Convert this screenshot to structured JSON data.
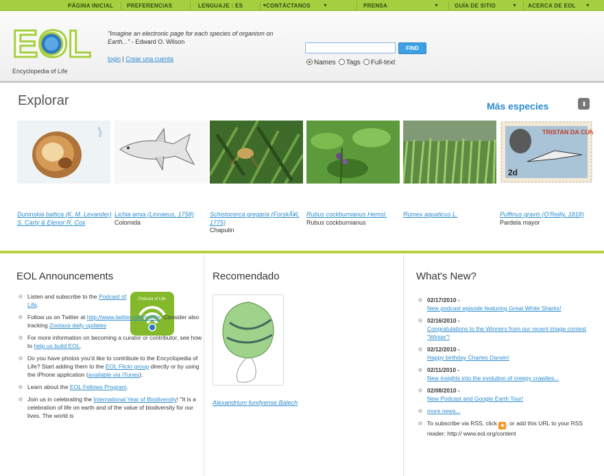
{
  "nav": {
    "items": [
      {
        "label": "PÁGINA INICIAL",
        "caret": false
      },
      {
        "label": "PREFERENCIAS",
        "caret": false
      },
      {
        "label": "LENGUAJE : ES",
        "caret": true
      },
      {
        "label": "CONTÁCTANOS",
        "caret": true
      },
      {
        "label": "PRENSA",
        "caret": true
      },
      {
        "label": "GUÍA DE SITIO",
        "caret": true
      },
      {
        "label": "ACERCA DE EOL",
        "caret": true
      }
    ]
  },
  "header": {
    "logo_text": "EOL",
    "logo_subtitle": "Encyclopedia of Life",
    "quote": "\"Imagine an electronic page for each species of organism on Earth...\"",
    "quote_author": "- Edward O. Wilson",
    "login": "login",
    "separator": "|",
    "create_account": "Crear una cuenta"
  },
  "search": {
    "placeholder": "",
    "button": "FIND",
    "options": [
      "Names",
      "Tags",
      "Full-text"
    ],
    "selected": "Names"
  },
  "explore": {
    "title": "Explorar",
    "more": "Más especies",
    "pause": "II",
    "species": [
      {
        "sci": "Duninskia baltica (K. M. Levander) S. Carty & Elenor R. Cox",
        "common": "",
        "icon": "cell-image"
      },
      {
        "sci": "Lichia amia (Linnaeus, 1758)",
        "common": "Colomida",
        "icon": "fish-image"
      },
      {
        "sci": "Schistocerca gregaria (ForskÃ¥l, 1775)",
        "common": "Chapulin",
        "icon": "locust-image"
      },
      {
        "sci": "Rubus cockburnianus Hemsl.",
        "common": "Rubus cockburnianus",
        "icon": "plant-image"
      },
      {
        "sci": "Rumex aquaticus L.",
        "common": "",
        "icon": "field-image"
      },
      {
        "sci": "Puffinus gravis (O'Reilly, 1818)",
        "common": "Pardela mayor",
        "icon": "stamp-image"
      }
    ]
  },
  "stamp": {
    "country": "TRISTAN DA CUNHA",
    "value": "2d"
  },
  "announcements": {
    "title": "EOL Announcements",
    "badge_text": "Podcast of Life",
    "items": [
      {
        "parts": [
          {
            "t": "Listen and subscribe to the "
          },
          {
            "t": "Podcast of Life",
            "link": true
          },
          {
            "t": "."
          }
        ]
      },
      {
        "parts": [
          {
            "t": "Follow us on Twitter at "
          },
          {
            "t": "http://www.twitter.com/eolfile",
            "link": true
          },
          {
            "t": ". Consider also tracking "
          },
          {
            "t": "Zootaxa daily updates",
            "link": true
          }
        ]
      },
      {
        "parts": [
          {
            "t": "For more information on becoming a curator or contributor, see how to "
          },
          {
            "t": "help us build EOL",
            "link": true
          },
          {
            "t": "."
          }
        ]
      },
      {
        "parts": [
          {
            "t": "Do you have photos you'd like to contribute to the Encyclopedia of Life? Start adding them to the "
          },
          {
            "t": "EOL Flickr group",
            "link": true
          },
          {
            "t": " directly or by using the iPhone application ("
          },
          {
            "t": "available via iTunes",
            "link": true
          },
          {
            "t": ")."
          }
        ]
      },
      {
        "parts": [
          {
            "t": "Learn about the "
          },
          {
            "t": "EOL Fellows Program",
            "link": true
          },
          {
            "t": "."
          }
        ]
      },
      {
        "parts": [
          {
            "t": "Join us in celebrating the "
          },
          {
            "t": "International Year of Biodiversity",
            "link": true
          },
          {
            "t": "! \"It is a celebration of life on earth and of the value of biodiversity for our lives. The world is"
          }
        ]
      }
    ]
  },
  "featured": {
    "title": "Recomendado",
    "caption": "Alexandrium fundyense Balech"
  },
  "news": {
    "title": "What's New?",
    "items": [
      {
        "date": "02/17/2010 -",
        "text": "New podcast episode featuring Great White Sharks!"
      },
      {
        "date": "02/16/2010 -",
        "text": "Congratulations to the Winners from our recent image contest \"Winter\"!"
      },
      {
        "date": "02/12/2010 -",
        "text": "Happy birthday Charles Darwin!"
      },
      {
        "date": "02/11/2010 -",
        "text": "New insights into the evolution of creepy crawlies..."
      },
      {
        "date": "02/08/2010 -",
        "text": "New Podcast and Google Earth Tour!"
      }
    ],
    "more": "more news...",
    "rss_prefix": "To subscribe via RSS, click",
    "rss_suffix": ", or add this URL to your RSS reader: http:// www.eol.org/content"
  },
  "colors": {
    "nav_green": "#a6cf3f",
    "link_blue": "#2a8ccf",
    "find_blue": "#3ba1e4",
    "divider_green": "#b6d13b"
  }
}
